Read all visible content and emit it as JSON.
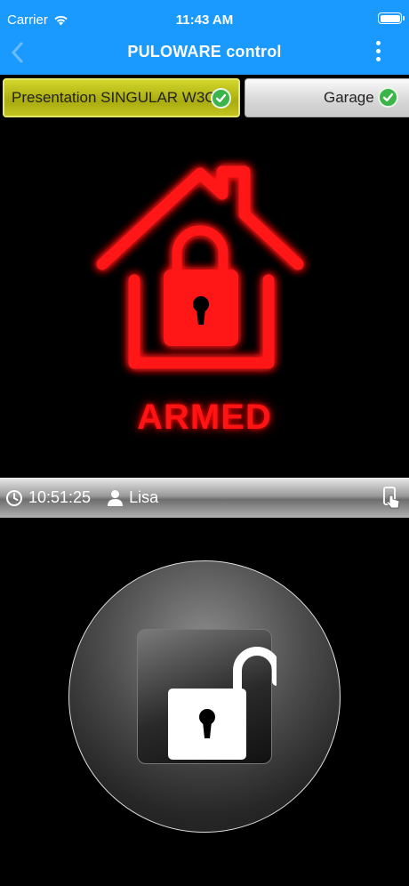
{
  "status_bar": {
    "carrier": "Carrier",
    "time": "11:43 AM"
  },
  "nav": {
    "title": "PULOWARE control",
    "back_icon": "chevron-left-icon",
    "menu_icon": "more-vertical-icon"
  },
  "tabs": [
    {
      "label": "Presentation SINGULAR W3G",
      "selected": true,
      "status_icon": "check-circle-icon"
    },
    {
      "label": "Garage",
      "selected": false,
      "status_icon": "check-circle-icon"
    }
  ],
  "alarm": {
    "state": "ARMED",
    "icon": "house-lock-icon",
    "color": "#ff1313"
  },
  "info": {
    "time": "10:51:25",
    "user": "Lisa",
    "touch_icon": "hand-touch-icon"
  },
  "action": {
    "icon": "unlock-icon"
  },
  "colors": {
    "header": "#1a99ff",
    "tab_selected": "#bcbf1c",
    "check": "#3bb449",
    "armed": "#ff1313"
  }
}
